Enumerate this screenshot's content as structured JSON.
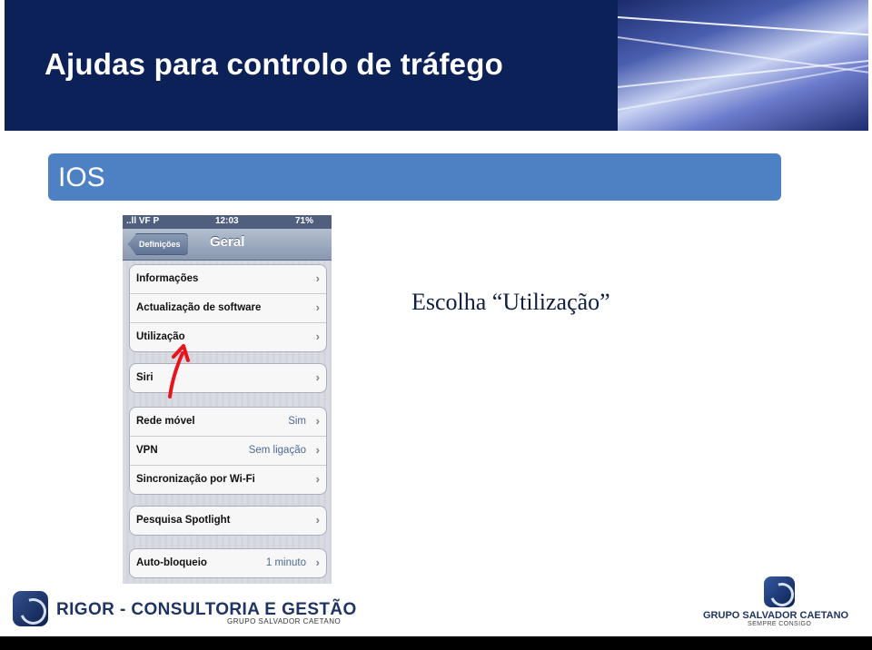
{
  "header": {
    "title": "Ajudas para controlo de tráfego",
    "background_color": "#0b2157"
  },
  "section": {
    "label": "IOS",
    "color": "#4e81c4"
  },
  "phone": {
    "status": {
      "carrier": "..ll VF P",
      "time": "12:03",
      "battery": "71%"
    },
    "nav": {
      "back_label": "Definições",
      "title": "Geral"
    },
    "groups": [
      {
        "rows": [
          {
            "label": "Informações",
            "value": ""
          },
          {
            "label": "Actualização de software",
            "value": ""
          },
          {
            "label": "Utilização",
            "value": ""
          }
        ]
      },
      {
        "rows": [
          {
            "label": "Siri",
            "value": ""
          }
        ]
      },
      {
        "rows": [
          {
            "label": "Rede móvel",
            "value": "Sim"
          },
          {
            "label": "VPN",
            "value": "Sem ligação"
          },
          {
            "label": "Sincronização por Wi-Fi",
            "value": ""
          }
        ]
      },
      {
        "rows": [
          {
            "label": "Pesquisa Spotlight",
            "value": ""
          }
        ]
      },
      {
        "rows": [
          {
            "label": "Auto-bloqueio",
            "value": "1 minuto"
          }
        ]
      }
    ],
    "chevron": "›"
  },
  "instruction": "Escolha “Utilização”",
  "footer": {
    "left_brand": "RIGOR - CONSULTORIA E GESTÃO",
    "left_sub": "GRUPO SALVADOR CAETANO",
    "right_brand": "GRUPO SALVADOR CAETANO",
    "right_sub": "SEMPRE CONSIGO"
  }
}
